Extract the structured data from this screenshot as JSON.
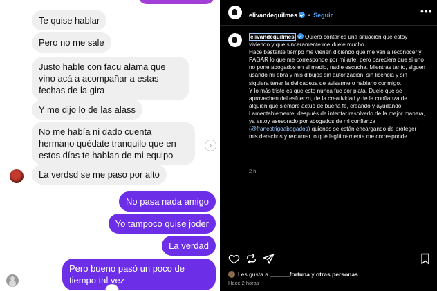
{
  "chat": {
    "incoming": [
      "Te quise hablar",
      "Pero no me sale",
      "Justo hable con facu alama que vino acá a acompañar a estas fechas de la gira",
      "Y me dijo lo de las alass",
      "No me había ni dado cuenta hermano quédate tranquilo que en estos días te hablan de mi equipo",
      "La verdsd se me paso por alto"
    ],
    "outgoing": [
      "No pasa nada amigo",
      "Yo tampoco quise joder",
      "La verdad",
      "Pero bueno pasó un poco de tiempo tal vez"
    ],
    "colors": {
      "incoming_bg": "#efefef",
      "outgoing_bg": "#6c2ee6"
    }
  },
  "post": {
    "username": "elivandequilmes",
    "separator": "•",
    "follow_label": "Seguir",
    "caption_username": "elivandequilmes",
    "caption": [
      "Quiero contarles una situación que estoy viviendo y que sinceramente me duele mucho.",
      "Hace bastante tiempo me vienen diciendo que me van a reconocer y PAGAR lo que me corresponde por mi arte, pero pareciera que si uno no pone abogados en el medio, nadie escucha. Mientras tanto, siguen usando mi obra y mis dibujos sin autorización, sin licencia y sin siquiera tener la delicadeza de avisarme o hablarlo conmigo.",
      "Y lo más triste es que esto nunca fue por plata. Duele que se aprovechen del esfuerzo, de la creatividad y de la confianza de alguien que siempre actuó de buena fe, creando y ayudando.",
      "Lamentablemente, después de intentar resolverlo de la mejor manera, ya estoy asesorado por abogados de mi confianza"
    ],
    "mention": "(@francotrigoabogados)",
    "caption_tail": " quienes se están encargando de proteger mis derechos y reclamar lo que legítimamente me corresponde.",
    "caption_time": "2 h",
    "likes_prefix": "Les gusta a ",
    "likes_user": "______fortuna",
    "likes_mid": " y ",
    "likes_others": "otras personas",
    "posted_ago": "Hace 2 horas",
    "icons": [
      "heart-icon",
      "repost-icon",
      "share-icon",
      "bookmark-icon",
      "more-icon"
    ]
  }
}
